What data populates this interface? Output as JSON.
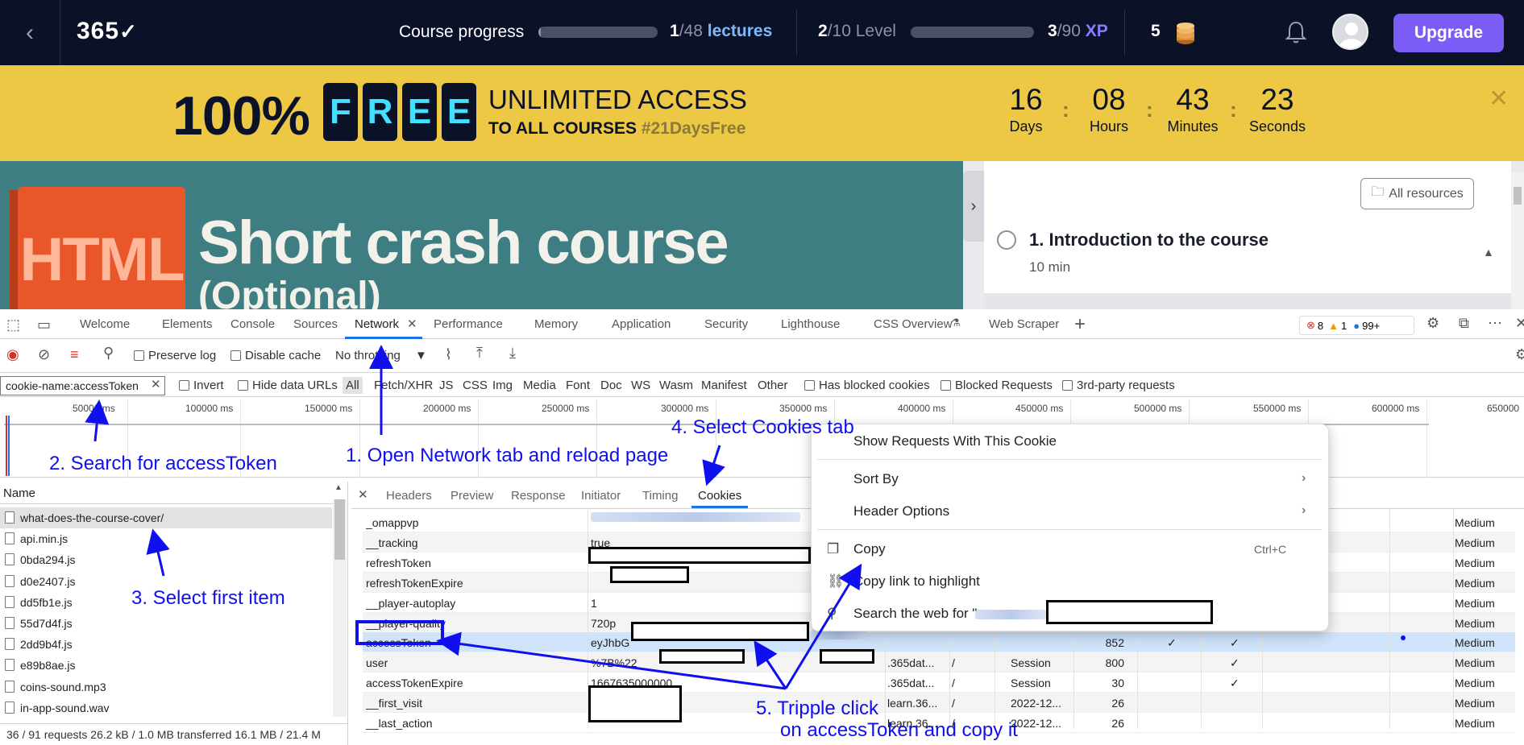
{
  "topnav": {
    "logo": "365",
    "progress_label": "Course progress",
    "lectures_done": "1",
    "lectures_total": "/48",
    "lectures_word": "lectures",
    "lecture_progress": 0.02,
    "level_current": "2",
    "level_total": "/10 Level",
    "level_progress": 0.0,
    "xp_current": "3",
    "xp_total": "/90",
    "xp_word": "XP",
    "coins": "5",
    "upgrade_label": "Upgrade",
    "accent_color": "#7c5cf7"
  },
  "promo": {
    "percent": "100%",
    "free_letters": [
      "F",
      "R",
      "E",
      "E"
    ],
    "line1": "UNLIMITED ACCESS",
    "line2": "TO ALL COURSES",
    "hashtag": "#21DaysFree",
    "countdown": [
      {
        "value": "16",
        "label": "Days"
      },
      {
        "value": "08",
        "label": "Hours"
      },
      {
        "value": "43",
        "label": "Minutes"
      },
      {
        "value": "23",
        "label": "Seconds"
      }
    ],
    "close": "✕",
    "bg_color": "#ecc845"
  },
  "course": {
    "badge": "HTML",
    "title1": "Short crash course",
    "title2": "(Optional)",
    "all_resources": "All resources",
    "lesson_title": "1. Introduction to the course",
    "lesson_duration": "10 min"
  },
  "devtools": {
    "tabs": [
      "Welcome",
      "Elements",
      "Console",
      "Sources",
      "Network",
      "Performance",
      "Memory",
      "Application",
      "Security",
      "Lighthouse",
      "CSS Overview",
      "Web Scraper"
    ],
    "active_tab": "Network",
    "errors": "8",
    "warnings": "1",
    "issues": "99+",
    "toolbar": {
      "preserve_log": "Preserve log",
      "disable_cache": "Disable cache",
      "throttling": "No throttling"
    },
    "filter": {
      "value": "cookie-name:accessToken",
      "invert": "Invert",
      "hide_data_urls": "Hide data URLs",
      "types": [
        "All",
        "Fetch/XHR",
        "JS",
        "CSS",
        "Img",
        "Media",
        "Font",
        "Doc",
        "WS",
        "Wasm",
        "Manifest",
        "Other"
      ],
      "has_blocked": "Has blocked cookies",
      "blocked_requests": "Blocked Requests",
      "third_party": "3rd-party requests"
    },
    "timeline_ticks": [
      "50000 ms",
      "100000 ms",
      "150000 ms",
      "200000 ms",
      "250000 ms",
      "300000 ms",
      "350000 ms",
      "400000 ms",
      "450000 ms",
      "500000 ms",
      "550000 ms",
      "600000 ms",
      "650000"
    ],
    "requests_header": "Name",
    "requests": [
      "what-does-the-course-cover/",
      "api.min.js",
      "0bda294.js",
      "d0e2407.js",
      "dd5fb1e.js",
      "55d7d4f.js",
      "2dd9b4f.js",
      "e89b8ae.js",
      "coins-sound.mp3",
      "in-app-sound.wav"
    ],
    "status": "36 / 91 requests   26.2 kB / 1.0 MB transferred   16.1 MB / 21.4 M",
    "detail_tabs": [
      "Headers",
      "Preview",
      "Response",
      "Initiator",
      "Timing",
      "Cookies"
    ],
    "cookies": [
      {
        "name": "_omappvp",
        "value": "",
        "domain": "",
        "path": "",
        "expires": "",
        "size": "",
        "http": "",
        "secure": "",
        "priority": "Medium"
      },
      {
        "name": "__tracking",
        "value": "true",
        "domain": "",
        "path": "",
        "expires": "",
        "size": "",
        "http": "",
        "secure": "",
        "priority": "Medium"
      },
      {
        "name": "refreshToken",
        "value": "",
        "domain": "",
        "path": "",
        "expires": "",
        "size": "",
        "http": "",
        "secure": "",
        "priority": "Medium"
      },
      {
        "name": "refreshTokenExpire",
        "value": "",
        "domain": "",
        "path": "",
        "expires": "",
        "size": "",
        "http": "",
        "secure": "",
        "priority": "Medium"
      },
      {
        "name": "__player-autoplay",
        "value": "1",
        "domain": "",
        "path": "",
        "expires": "",
        "size": "",
        "http": "",
        "secure": "",
        "priority": "Medium"
      },
      {
        "name": "__player-quality",
        "value": "720p",
        "domain": "",
        "path": "",
        "expires": "",
        "size": "",
        "http": "",
        "secure": "",
        "priority": "Medium"
      },
      {
        "name": "accessToken",
        "value": "eyJhbG",
        "domain": "",
        "path": "",
        "expires": "",
        "size": "852",
        "http": "✓",
        "secure": "✓",
        "priority": "Medium"
      },
      {
        "name": "user",
        "value": "%7B%22",
        "domain": ".365dat...",
        "path": "/",
        "expires": "Session",
        "size": "800",
        "http": "",
        "secure": "✓",
        "priority": "Medium"
      },
      {
        "name": "accessTokenExpire",
        "value": "1667635000000",
        "domain": ".365dat...",
        "path": "/",
        "expires": "Session",
        "size": "30",
        "http": "",
        "secure": "✓",
        "priority": "Medium"
      },
      {
        "name": "__first_visit",
        "value": "",
        "domain": "learn.36...",
        "path": "/",
        "expires": "2022-12...",
        "size": "26",
        "http": "",
        "secure": "",
        "priority": "Medium"
      },
      {
        "name": "__last_action",
        "value": "",
        "domain": "learn.36...",
        "path": "/",
        "expires": "2022-12...",
        "size": "26",
        "http": "",
        "secure": "",
        "priority": "Medium"
      }
    ]
  },
  "context_menu": {
    "show_requests": "Show Requests With This Cookie",
    "sort_by": "Sort By",
    "header_options": "Header Options",
    "copy": "Copy",
    "copy_shortcut": "Ctrl+C",
    "copy_link": "Copy link to highlight",
    "search_web": "Search the web for \"",
    "search_web_end": "\""
  },
  "annotations": {
    "step1": "1. Open Network tab and reload page",
    "step2": "2. Search for accessToken",
    "step3": "3. Select first item",
    "step4": "4. Select Cookies tab",
    "step5a": "5. Tripple click",
    "step5b": "on accessToken and copy it",
    "color": "#1010ee"
  }
}
